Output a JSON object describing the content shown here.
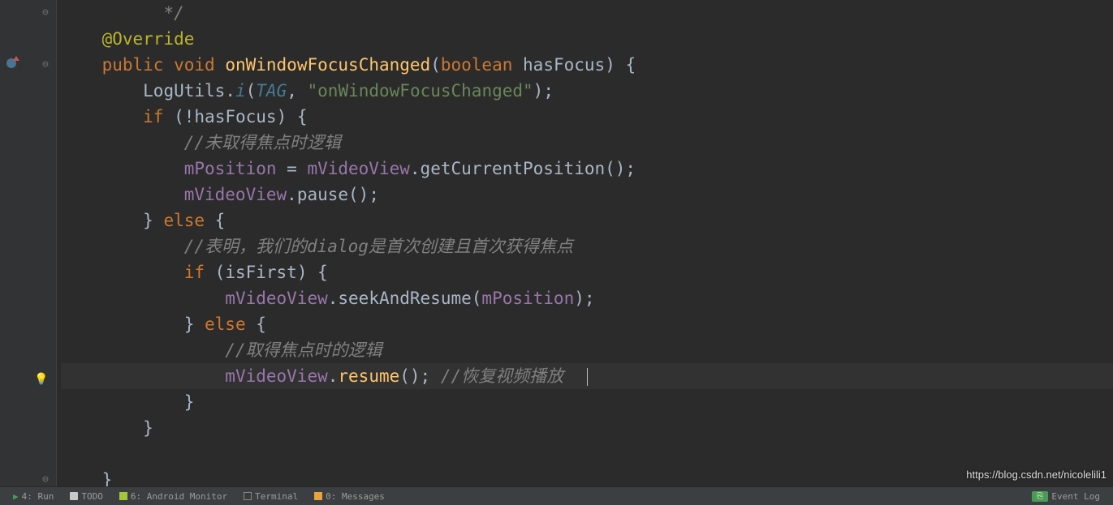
{
  "code": {
    "l1_comment": "*/",
    "l2_annotation": "@Override",
    "l3_public": "public",
    "l3_void": "void",
    "l3_method": "onWindowFocusChanged",
    "l3_boolean": "boolean",
    "l3_param": "hasFocus",
    "l4_class": "LogUtils",
    "l4_method": "i",
    "l4_tag": "TAG",
    "l4_str": "\"onWindowFocusChanged\"",
    "l5_if": "if",
    "l5_cond": "!hasFocus",
    "l6_comment": "//未取得焦点时逻辑",
    "l7_lhs": "mPosition",
    "l7_eq": " = ",
    "l7_obj": "mVideoView",
    "l7_call": "getCurrentPosition",
    "l8_obj": "mVideoView",
    "l8_call": "pause",
    "l9_else": "else",
    "l10_comment": "//表明，我们的dialog是首次创建且首次获得焦点",
    "l11_if": "if",
    "l11_cond": "isFirst",
    "l12_obj": "mVideoView",
    "l12_call": "seekAndResume",
    "l12_arg": "mPosition",
    "l13_else": "else",
    "l14_comment": "//取得焦点时的逻辑",
    "l15_obj": "mVideoView",
    "l15_call": "resume",
    "l15_comment": "//恢复视频播放"
  },
  "bottombar": {
    "run": "4: Run",
    "todo": "TODO",
    "android": "6: Android Monitor",
    "terminal": "Terminal",
    "messages": "0: Messages",
    "eventlog": "Event Log"
  },
  "watermark": "https://blog.csdn.net/nicolelili1"
}
